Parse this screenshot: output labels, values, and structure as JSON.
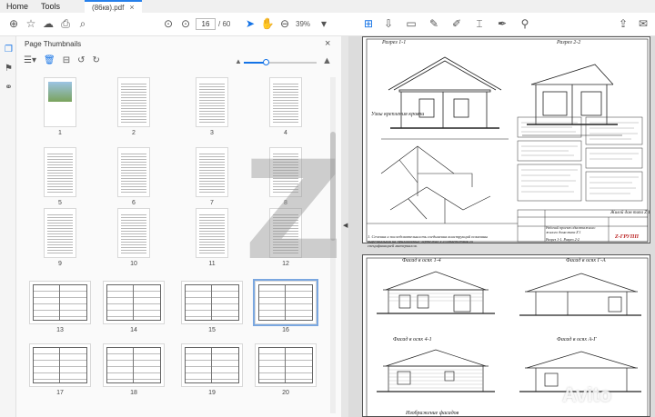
{
  "menu": {
    "home": "Home",
    "tools": "Tools"
  },
  "tab": {
    "title": "(86кв).pdf"
  },
  "toolbar": {
    "current_page": "16",
    "total_pages": "/ 60",
    "zoom": "39%"
  },
  "panel": {
    "title": "Page Thumbnails",
    "thumb_size_fraction": 0.3
  },
  "thumbnails": [
    "1",
    "2",
    "3",
    "4",
    "5",
    "6",
    "7",
    "8",
    "9",
    "10",
    "11",
    "12",
    "13",
    "14",
    "15",
    "16",
    "17",
    "18",
    "19",
    "20"
  ],
  "selected_page": "16",
  "doc": {
    "sheet1": {
      "section_1": "Разрез 1-1",
      "section_2": "Разрез 2-2",
      "nodes": "Узлы крепления кровли",
      "title_block": "Жилой дом типа Z 1",
      "title_sub": "Рабочий проект одноэтажного жилого дома типа Z 1",
      "sheet_name": "Разрез 1-1. Разрез 2-2",
      "logo": "Z-ГРУПП",
      "note": "1. Сечения и последовательность соединения конструкций показаны вырезанными на прилагаемых чертежах в соответствии со спецификацией материалов."
    },
    "sheet2": {
      "facade_1": "Фасад в осях 1-4",
      "facade_2": "Фасад в осях Г-А",
      "facade_3": "Фасад в осях 4-1",
      "facade_4": "Фасад в осях А-Г",
      "bottom": "Изображение фасадов"
    }
  },
  "watermark": "Z",
  "avito": "Avito"
}
